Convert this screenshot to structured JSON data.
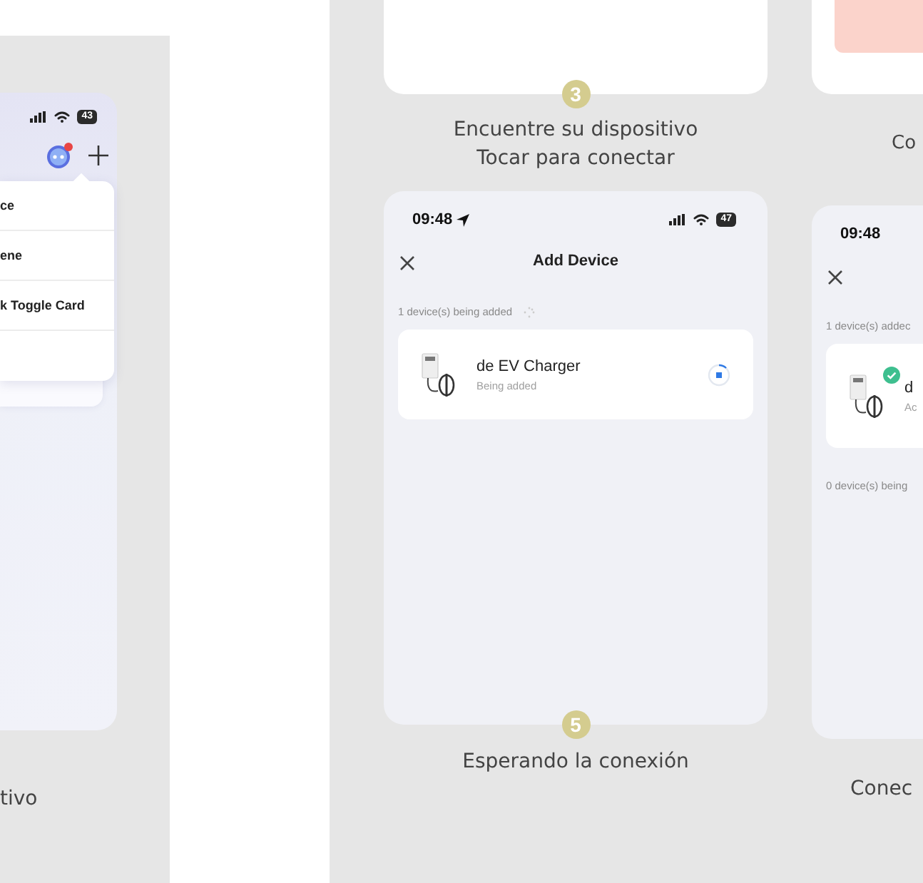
{
  "left_panel": {
    "status_bar": {
      "battery": "43"
    },
    "menu": {
      "items": [
        {
          "kind": "text",
          "label": "ce"
        },
        {
          "kind": "text",
          "label": "ene"
        },
        {
          "kind": "text",
          "label": "k Toggle Card"
        }
      ]
    },
    "caption": "tivo"
  },
  "top_row": {
    "step_badge": "3",
    "caption_lines": [
      "Encuentre su dispositivo",
      "Tocar para conectar"
    ],
    "right_caption": "Co"
  },
  "screens": [
    {
      "time": "09:48",
      "location": true,
      "battery": "47",
      "title": "Add Device",
      "section_label": "1 device(s) being added",
      "device": {
        "name": "de EV Charger",
        "status": "Being added",
        "added": false
      },
      "step_badge": "5",
      "caption": "Esperando la conexión"
    },
    {
      "time": "09:48",
      "location": false,
      "section_label": "1 device(s) addec",
      "device": {
        "name": "d",
        "status": "Ac",
        "added": true
      },
      "footer_label": "0 device(s) being",
      "caption": "Conec"
    }
  ]
}
